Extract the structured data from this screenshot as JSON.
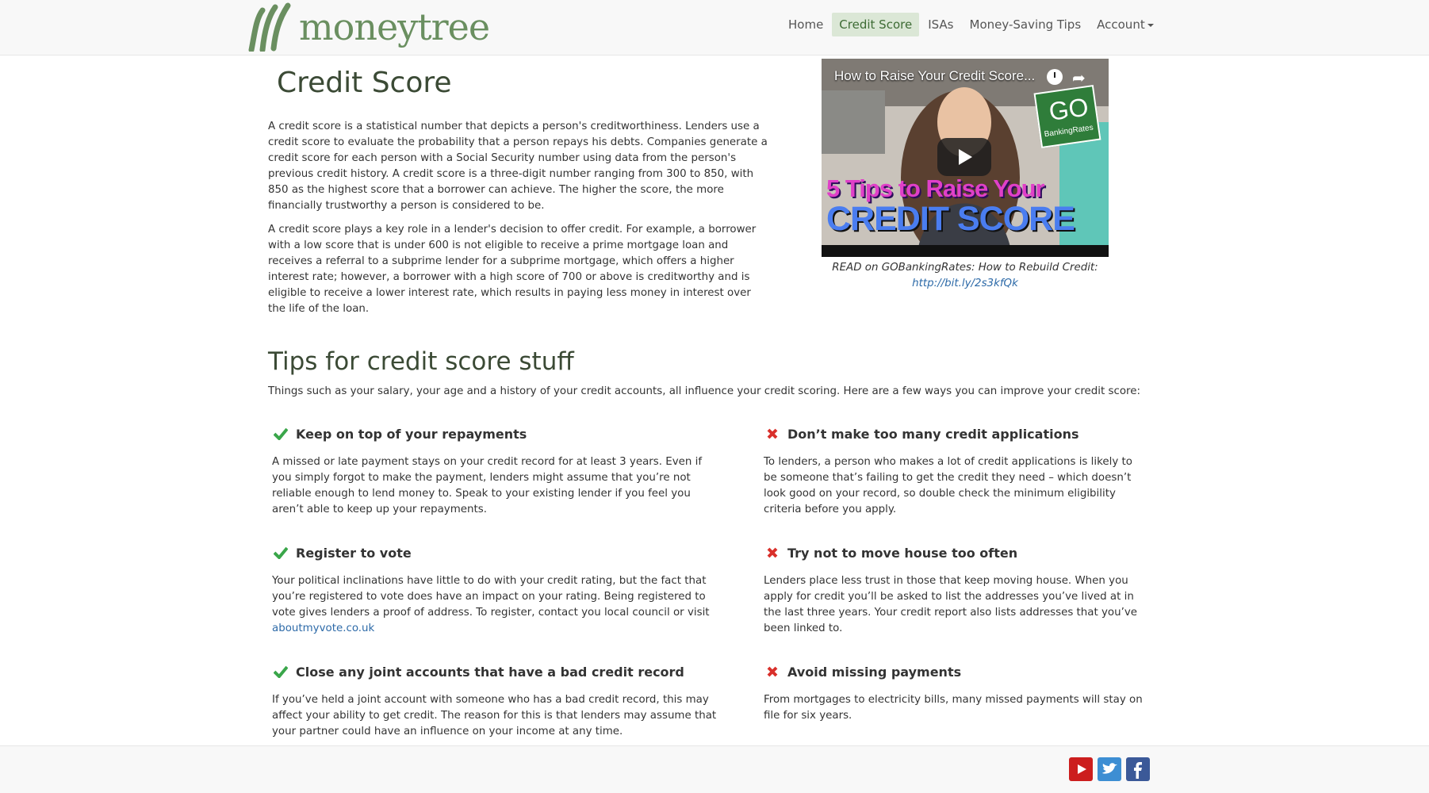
{
  "brand": {
    "name": "moneytree"
  },
  "nav": {
    "items": [
      {
        "label": "Home",
        "active": false
      },
      {
        "label": "Credit Score",
        "active": true
      },
      {
        "label": "ISAs",
        "active": false
      },
      {
        "label": "Money-Saving Tips",
        "active": false
      }
    ],
    "account_label": "Account"
  },
  "page": {
    "title": "Credit Score",
    "intro_paragraphs": [
      "A credit score is a statistical number that depicts a person's creditworthiness. Lenders use a credit score to evaluate the probability that a person repays his debts. Companies generate a credit score for each person with a Social Security number using data from the person's previous credit history. A credit score is a three-digit number ranging from 300 to 850, with 850 as the highest score that a borrower can achieve. The higher the score, the more financially trustworthy a person is considered to be.",
      "A credit score plays a key role in a lender's decision to offer credit. For example, a borrower with a low score that is under 600 is not eligible to receive a prime mortgage loan and receives a referral to a subprime lender for a subprime mortgage, which offers a higher interest rate; however, a borrower with a high score of 700 or above is creditworthy and is eligible to receive a lower interest rate, which results in paying less money in interest over the life of the loan."
    ]
  },
  "video": {
    "title": "How to Raise Your Credit Score...",
    "overlay_line1": "5 Tips to Raise Your",
    "overlay_line2": "CREDIT SCORE",
    "logo_text": "GO",
    "logo_subtext": "BankingRates",
    "caption_text": "READ on GOBankingRates: How to Rebuild Credit: ",
    "caption_link": "http://bit.ly/2s3kfQk"
  },
  "tips": {
    "title": "Tips for credit score stuff",
    "intro": "Things such as your salary, your age and a history of your credit accounts, all influence your credit scoring. Here are a few ways you can improve your credit score:",
    "do": [
      {
        "title": "Keep on top of your repayments",
        "body": "A missed or late payment stays on your credit record for at least 3 years. Even if you simply forgot to make the payment, lenders might assume that you’re not reliable enough to lend money to. Speak to your existing lender if you feel you aren’t able to keep up your repayments."
      },
      {
        "title": "Register to vote",
        "body": "Your political inclinations have little to do with your credit rating, but the fact that you’re registered to vote does have an impact on your rating. Being registered to vote gives lenders a proof of address. To register, contact you local council or visit ",
        "link": "aboutmyvote.co.uk"
      },
      {
        "title": "Close any joint accounts that have a bad credit record",
        "body": "If you’ve held a joint account with someone who has a bad credit record, this may affect your ability to get credit. The reason for this is that lenders may assume that your partner could have an influence on your income at any time."
      }
    ],
    "dont": [
      {
        "title": "Don’t make too many credit applications",
        "body": "To lenders, a person who makes a lot of credit applications is likely to be someone that’s failing to get the credit they need – which doesn’t look good on your record, so double check the minimum eligibility criteria before you apply."
      },
      {
        "title": "Try not to move house too often",
        "body": "Lenders place less trust in those that keep moving house. When you apply for credit you’ll be asked to list the addresses you’ve lived at in the last three years. Your credit report also lists addresses that you’ve been linked to."
      },
      {
        "title": "Avoid missing payments",
        "body": "From mortgages to electricity bills, many missed payments will stay on file for six years."
      }
    ]
  },
  "colors": {
    "brand_green": "#6a8f60",
    "check_green": "#3aa64a",
    "cross_red": "#d9302b",
    "link_blue": "#2d6aa8"
  },
  "footer": {
    "social_icons": [
      "youtube-icon",
      "twitter-icon",
      "facebook-icon"
    ]
  }
}
